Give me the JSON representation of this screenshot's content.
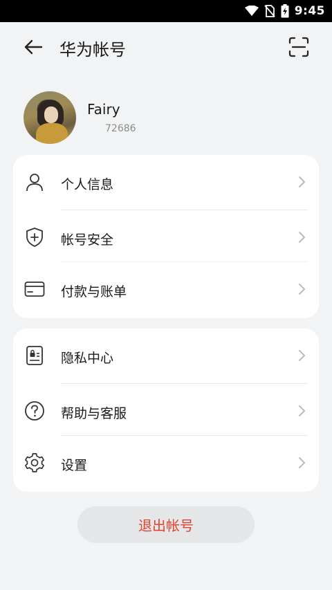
{
  "status_bar": {
    "time": "9:45",
    "icons": [
      "wifi-icon",
      "no-sim-icon",
      "battery-charging-icon"
    ]
  },
  "header": {
    "back_icon": "back-arrow-icon",
    "title": "华为帐号",
    "scan_icon": "scan-icon"
  },
  "profile": {
    "name": "Fairy",
    "account_id": "72686"
  },
  "menu_group_1": [
    {
      "label": "个人信息",
      "icon": "person-icon"
    },
    {
      "label": "帐号安全",
      "icon": "shield-icon"
    },
    {
      "label": "付款与账单",
      "icon": "card-icon"
    }
  ],
  "menu_group_2": [
    {
      "label": "隐私中心",
      "icon": "privacy-icon"
    },
    {
      "label": "帮助与客服",
      "icon": "help-icon"
    },
    {
      "label": "设置",
      "icon": "gear-icon"
    }
  ],
  "logout": {
    "label": "退出帐号",
    "color": "#e0442e"
  },
  "colors": {
    "background": "#f1f3f5",
    "card": "#ffffff",
    "accent_red": "#e0442e"
  }
}
